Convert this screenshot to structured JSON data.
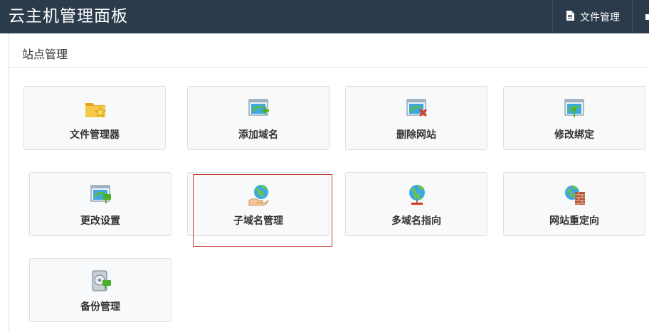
{
  "app": {
    "title": "云主机管理面板"
  },
  "topnav": {
    "file_manager": "文件管理"
  },
  "panel": {
    "title": "站点管理"
  },
  "tiles": [
    {
      "label": "文件管理器",
      "icon": "folder-star-icon"
    },
    {
      "label": "添加域名",
      "icon": "window-globe-add-icon"
    },
    {
      "label": "删除网站",
      "icon": "window-globe-delete-icon"
    },
    {
      "label": "修改绑定",
      "icon": "window-globe-person-icon"
    },
    {
      "label": "更改设置",
      "icon": "window-globe-tag-icon"
    },
    {
      "label": "子域名管理",
      "icon": "globe-hand-icon"
    },
    {
      "label": "多域名指向",
      "icon": "globe-network-icon"
    },
    {
      "label": "网站重定向",
      "icon": "globe-wall-icon"
    },
    {
      "label": "备份管理",
      "icon": "disk-backup-icon"
    }
  ],
  "colors": {
    "topbar": "#2b3b4c",
    "highlight": "#c0392b",
    "tile_bg": "#f8f9fb"
  }
}
